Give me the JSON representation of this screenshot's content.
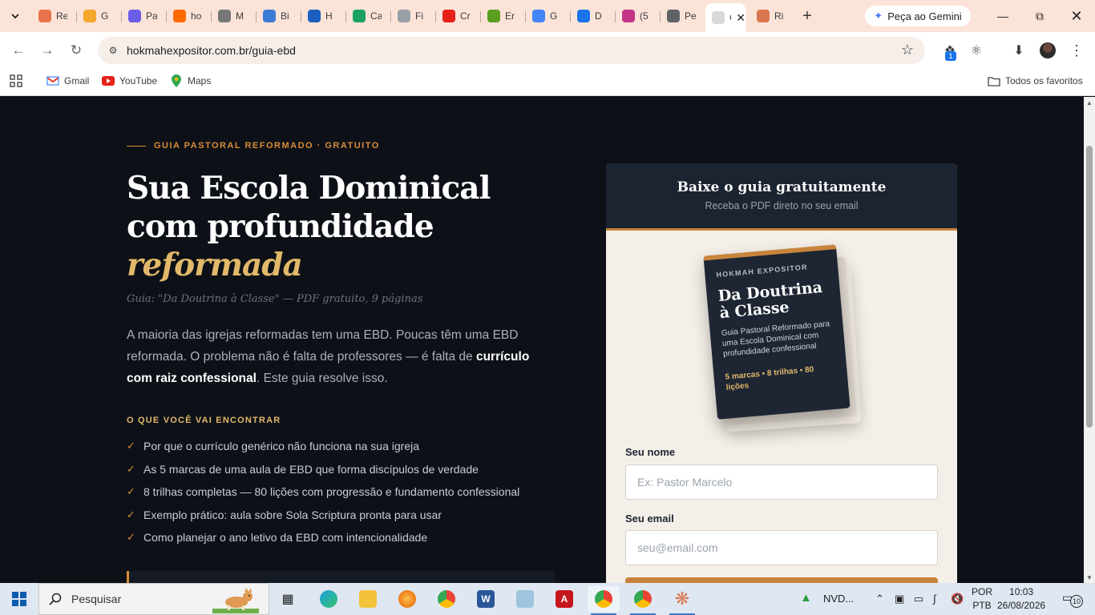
{
  "browser": {
    "tabs": [
      {
        "label": "Re",
        "color": "#e8734a"
      },
      {
        "label": "G",
        "color": "#f4a52b"
      },
      {
        "label": "Pa",
        "color": "#6b5de8"
      },
      {
        "label": "ho",
        "color": "#ff6a00"
      },
      {
        "label": "M",
        "color": "#777777"
      },
      {
        "label": "Bi",
        "color": "#3a7bd5"
      },
      {
        "label": "H",
        "color": "#1b5fbf"
      },
      {
        "label": "Ca",
        "color": "#1aa260"
      },
      {
        "label": "Fi",
        "color": "#9aa0a6"
      },
      {
        "label": "Cr",
        "color": "#e62117"
      },
      {
        "label": "Er",
        "color": "#5c9e1f"
      },
      {
        "label": "G",
        "color": "#4285f4"
      },
      {
        "label": "D",
        "color": "#1a73e8"
      },
      {
        "label": "(5",
        "color": "#c13584"
      },
      {
        "label": "Pe",
        "color": "#5f6368"
      },
      {
        "label": "G",
        "color": "#d9d9d9"
      },
      {
        "label": "Ri",
        "color": "#d9784f"
      }
    ],
    "active_tab_index": 15,
    "gemini_label": "Peça ao Gemini",
    "url": "hokmahexpositor.com.br/guia-ebd",
    "extension_badge": "1",
    "bookmarks": [
      {
        "label": "Gmail",
        "icon": "gmail-icon"
      },
      {
        "label": "YouTube",
        "icon": "youtube-icon"
      },
      {
        "label": "Maps",
        "icon": "maps-icon"
      }
    ],
    "all_bookmarks_label": "Todos os favoritos"
  },
  "hero": {
    "eyebrow": "GUIA PASTORAL REFORMADO · GRATUITO",
    "headline_line1": "Sua Escola Dominical",
    "headline_line2": "com profundidade",
    "headline_accent": "reformada",
    "subtitle": "Guia: \"Da Doutrina à Classe\" — PDF gratuito, 9 páginas",
    "intro_part1": "A maioria das igrejas reformadas tem uma EBD. Poucas têm uma EBD reformada. O problema não é falta de professores — é falta de ",
    "intro_strong": "currículo com raiz confessional",
    "intro_part2": ". Este guia resolve isso.",
    "section_label": "O QUE VOCÊ VAI ENCONTRAR",
    "benefits": [
      "Por que o currículo genérico não funciona na sua igreja",
      "As 5 marcas de uma aula de EBD que forma discípulos de verdade",
      "8 trilhas completas — 80 lições com progressão e fundamento confessional",
      "Exemplo prático: aula sobre Sola Scriptura pronta para usar",
      "Como planejar o ano letivo da EBD com intencionalidade"
    ]
  },
  "form": {
    "title": "Baixe o guia gratuitamente",
    "subtitle": "Receba o PDF direto no seu email",
    "book": {
      "brand": "HOKMAH EXPOSITOR",
      "title": "Da Doutrina à Classe",
      "description": "Guia Pastoral Reformado para uma Escola Dominical com profundidade confessional",
      "meta": "5 marcas • 8 trilhas • 80 lições"
    },
    "name_label": "Seu nome",
    "name_placeholder": "Ex: Pastor Marcelo",
    "email_label": "Seu email",
    "email_placeholder": "seu@email.com"
  },
  "taskbar": {
    "search_placeholder": "Pesquisar",
    "stock_label": "NVD...",
    "lang_line1": "POR",
    "lang_line2": "PTB",
    "time": "10:03",
    "date": "26/08/2026",
    "notification_count": "10"
  }
}
